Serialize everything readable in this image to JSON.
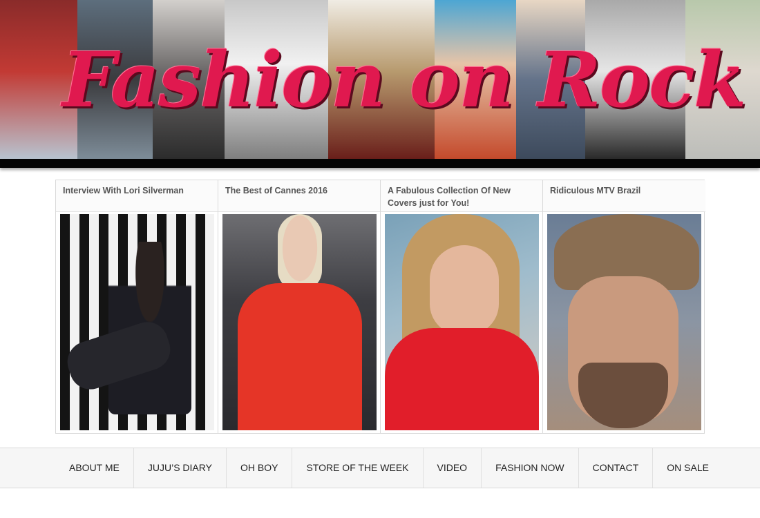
{
  "banner": {
    "title": "Fashion on Rock"
  },
  "featured": [
    {
      "title": "Interview With Lori Silverman",
      "image": "woman-posing-on-striped-backdrop"
    },
    {
      "title": "The Best of Cannes 2016",
      "image": "woman-in-red-dress-red-carpet"
    },
    {
      "title": "A Fabulous Collection Of New Covers just for You!",
      "image": "model-in-red-fur-portrait"
    },
    {
      "title": "Ridiculous MTV Brazil",
      "image": "man-in-brown-hat-portrait"
    }
  ],
  "menu": [
    {
      "label": "ABOUT ME"
    },
    {
      "label": "JUJU’S DIARY"
    },
    {
      "label": "OH BOY"
    },
    {
      "label": "STORE OF THE WEEK"
    },
    {
      "label": "VIDEO"
    },
    {
      "label": "FASHION NOW"
    },
    {
      "label": "CONTACT"
    },
    {
      "label": "ON SALE"
    }
  ],
  "colors": {
    "logo": "#e0194f",
    "banner_bar": "#050505",
    "menu_background": "#f6f6f6"
  }
}
